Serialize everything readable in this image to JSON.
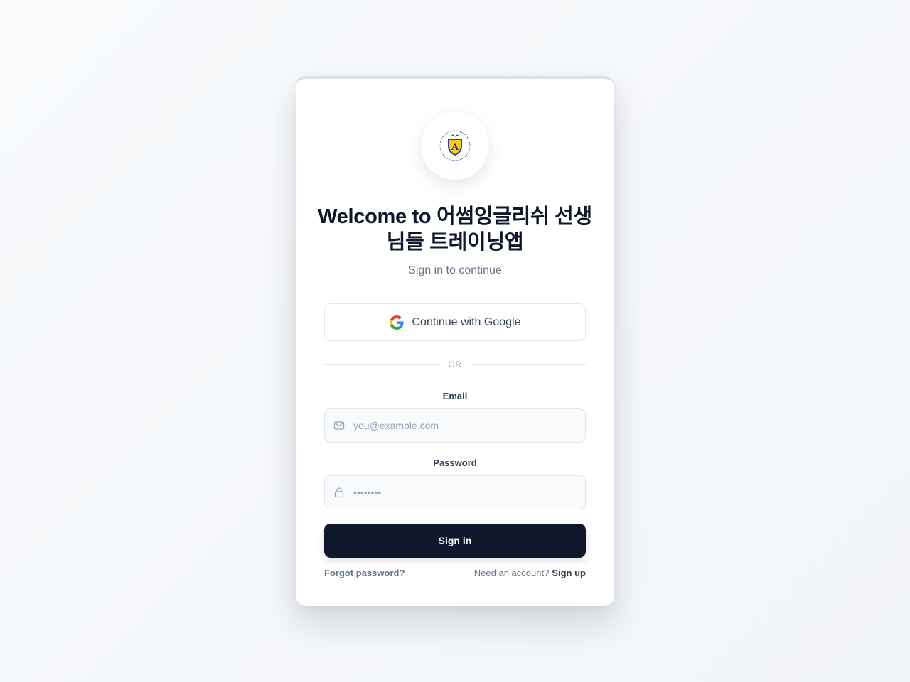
{
  "login": {
    "title": "Welcome to 어썸잉글리쉬 선생님들 트레이닝앱",
    "subtitle": "Sign in to continue",
    "google_label": "Continue with Google",
    "divider_text": "OR",
    "email": {
      "label": "Email",
      "placeholder": "you@example.com",
      "value": ""
    },
    "password": {
      "label": "Password",
      "placeholder": "••••••••",
      "value": ""
    },
    "signin_label": "Sign in",
    "forgot_label": "Forgot password?",
    "need_account_text": "Need an account?",
    "signup_label": "Sign up"
  },
  "icons": {
    "logo": "school-crest-logo",
    "google": "google-g-icon",
    "email": "mail-icon",
    "password": "lock-icon"
  },
  "colors": {
    "primary": "#0f172a",
    "text_muted": "#64748b",
    "border": "#e2e8f0",
    "input_bg": "#f8fafc"
  }
}
